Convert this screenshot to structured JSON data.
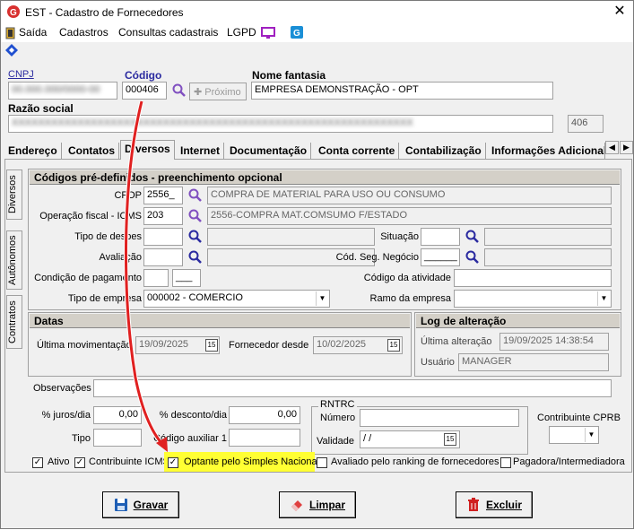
{
  "window": {
    "title": "EST - Cadastro de Fornecedores",
    "close": "✕"
  },
  "menu": {
    "saida": "Saída",
    "cadastros": "Cadastros",
    "consultas": "Consultas cadastrais",
    "lgpd": "LGPD"
  },
  "header": {
    "cnpj_label": "CNPJ",
    "cnpj_value": "00.000.000/0000-00",
    "codigo_label": "Código",
    "codigo_value": "000406",
    "proximo_label": "Próximo",
    "nome_fantasia_label": "Nome fantasia",
    "nome_fantasia_value": "EMPRESA DEMONSTRAÇÃO - OPT",
    "razao_social_label": "Razão social",
    "razao_social_value": "XXXXXXXXXXXXXXXXXXXXXXXXXXXXXXXXXXXXXXXXXXXXXXXXXXXXXXXXXXXXX",
    "numero_value": "406"
  },
  "tabs": [
    "Endereço",
    "Contatos",
    "Diversos",
    "Internet",
    "Documentação",
    "Conta corrente",
    "Contabilização",
    "Informações Adicional"
  ],
  "tab_arrows": {
    "left": "◀",
    "right": "▶"
  },
  "side_tabs": [
    "Diversos",
    "Autônomos",
    "Contratos"
  ],
  "codigos": {
    "title": "Códigos pré-definidos - preenchimento opcional",
    "cfop_label": "CFOP",
    "cfop_value": "2556_",
    "cfop_desc": "COMPRA DE MATERIAL PARA USO OU CONSUMO",
    "opfiscal_label": "Operação fiscal - ICMS",
    "opfiscal_value": "203",
    "opfiscal_desc": "2556-COMPRA MAT.COMSUMO F/ESTADO",
    "tipo_despesa_label": "Tipo de despes",
    "situacao_label": "Situação",
    "avaliacao_label": "Avaliação",
    "cod_seg_label": "Cód. Seg. Negócio",
    "cod_seg_value": "______",
    "cond_pag_label": "Condição de pagamento",
    "cond_pag_value2": "___",
    "cod_ativ_label": "Código da atividade",
    "tipo_empresa_label": "Tipo de empresa",
    "tipo_empresa_value": "000002 - COMERCIO",
    "ramo_label": "Ramo da empresa"
  },
  "datas": {
    "title": "Datas",
    "ultima_mov_label": "Última movimentação",
    "ultima_mov_value": "19/09/2025",
    "forn_desde_label": "Fornecedor desde",
    "forn_desde_value": "10/02/2025",
    "cal": "15"
  },
  "log": {
    "title": "Log de alteração",
    "ultima_alt_label": "Última alteração",
    "ultima_alt_value": "19/09/2025 14:38:54",
    "usuario_label": "Usuário",
    "usuario_value": "MANAGER"
  },
  "obs": {
    "label": "Observações"
  },
  "valores": {
    "juros_label": "% juros/dia",
    "juros_value": "0,00",
    "desconto_label": "% desconto/dia",
    "desconto_value": "0,00",
    "tipo_label": "Tipo",
    "cod_aux_label": "Código auxiliar 1"
  },
  "rntrc": {
    "title": "RNTRC",
    "numero_label": "Número",
    "validade_label": "Validade",
    "validade_value": " /  /"
  },
  "cprb": {
    "label": "Contribuinte CPRB"
  },
  "checks": {
    "ativo": "Ativo",
    "contribuinte": "Contribuinte ICMS",
    "optante": "Optante pelo Simples Nacional",
    "avaliado": "Avaliado pelo ranking de fornecedores",
    "pagadora": "Pagadora/Intermediadora",
    "check": "✓"
  },
  "buttons": {
    "gravar": "Gravar",
    "limpar": "Limpar",
    "excluir": "Excluir"
  },
  "colors": {
    "highlight": "#ffff33",
    "arrow": "#e02020",
    "accent": "#2a2aa0"
  }
}
